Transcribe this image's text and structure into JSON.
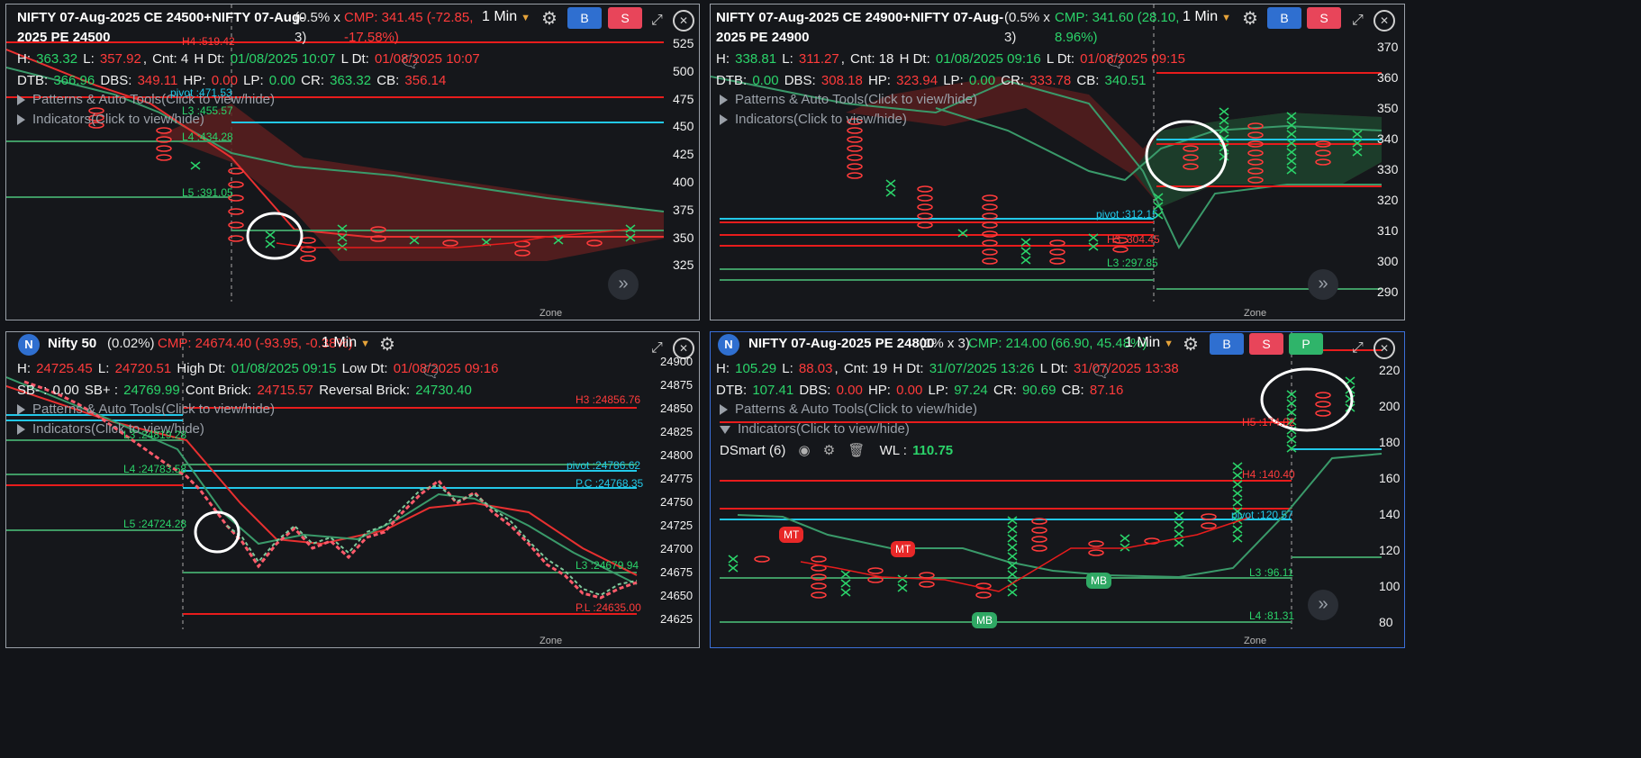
{
  "p1": {
    "title1": "NIFTY 07-Aug-2025 CE 24500+NIFTY 07-Aug-",
    "title2": "2025 PE 24500",
    "pct1": "(0.5% x",
    "pct2": "3)",
    "cmp1": "CMP: 341.45 (-72.85,",
    "cmp2": "-17.58%)",
    "timeframe": "1 Min",
    "h_lbl": "H:",
    "h": "363.32",
    "l_lbl": "L:",
    "l": "357.92",
    "cnt": "Cnt: 4",
    "hdt_lbl": "H Dt:",
    "hdt": "01/08/2025 10:07",
    "ldt_lbl": "L Dt:",
    "ldt": "01/08/2025 10:07",
    "dtb_lbl": "DTB:",
    "dtb": "366.96",
    "dbs_lbl": "DBS:",
    "dbs": "349.11",
    "hp_lbl": "HP:",
    "hp": "0.00",
    "lp_lbl": "LP:",
    "lp": "0.00",
    "cr_lbl": "CR:",
    "cr": "363.32",
    "cb_lbl": "CB:",
    "cb": "356.14",
    "patterns": "Patterns & Auto Tools(Click to view/hide)",
    "indicators": "Indicators(Click to view/hide)",
    "levels": {
      "h4": "H4 :519.42",
      "pivot": "pivot :471.53",
      "l3": "L3 :455.57",
      "l4": "L4 :434.28",
      "l5": "L5 :391.05"
    },
    "axis": [
      "525",
      "500",
      "475",
      "450",
      "425",
      "400",
      "375",
      "350",
      "325"
    ],
    "zone": "Zone (www.definedgesecurities.com)"
  },
  "p2": {
    "title1": "NIFTY 07-Aug-2025 CE 24900+NIFTY 07-Aug-",
    "title2": "2025 PE 24900",
    "pct1": "(0.5% x",
    "pct2": "3)",
    "cmp1": "CMP: 341.60 (28.10,",
    "cmp2": "8.96%)",
    "timeframe": "1 Min",
    "h_lbl": "H:",
    "h": "338.81",
    "l_lbl": "L:",
    "l": "311.27",
    "cnt": "Cnt: 18",
    "hdt_lbl": "H Dt:",
    "hdt": "01/08/2025 09:16",
    "ldt_lbl": "L Dt:",
    "ldt": "01/08/2025 09:15",
    "dtb_lbl": "DTB:",
    "dtb": "0.00",
    "dbs_lbl": "DBS:",
    "dbs": "308.18",
    "hp_lbl": "HP:",
    "hp": "323.94",
    "lp_lbl": "LP:",
    "lp": "0.00",
    "cr_lbl": "CR:",
    "cr": "333.78",
    "cb_lbl": "CB:",
    "cb": "340.51",
    "patterns": "Patterns & Auto Tools(Click to view/hide)",
    "indicators": "Indicators(Click to view/hide)",
    "levels": {
      "pivot": "pivot :312.15",
      "h3": "H3 :304.45",
      "l3": "L3 :297.85"
    },
    "axis": [
      "370",
      "360",
      "350",
      "340",
      "330",
      "320",
      "310",
      "300",
      "290"
    ],
    "zone": "Zone (www.definedgesecurities.com)"
  },
  "p3": {
    "badge": "N",
    "title": "Nifty 50",
    "pct": "(0.02%)",
    "cmp": "CMP: 24674.40 (-93.95, -0.38%)",
    "timeframe": "1 Min",
    "h_lbl": "H:",
    "h": "24725.45",
    "l_lbl": "L:",
    "l": "24720.51",
    "hdt_lbl": "High Dt:",
    "hdt": "01/08/2025 09:15",
    "ldt_lbl": "Low Dt:",
    "ldt": "01/08/2025 09:16",
    "sb_lbl": "SB- :",
    "sb": "0.00",
    "sbp_lbl": "SB+ :",
    "sbp": "24769.99",
    "cont_lbl": "Cont Brick:",
    "cont": "24715.57",
    "rev_lbl": "Reversal Brick:",
    "rev": "24730.40",
    "patterns": "Patterns & Auto Tools(Click to view/hide)",
    "indicators": "Indicators(Click to view/hide)",
    "levels": {
      "h3": "H3 :24856.76",
      "l3": "L3 :24819.28",
      "l4": "L4 :24783.58",
      "pivot": "pivot :24786.62",
      "pc": "P.C :24768.35",
      "l5": "L5 :24724.28",
      "l3b": "L3 :24679.94",
      "pl": "P.L :24635.00"
    },
    "axis": [
      "24900",
      "24875",
      "24850",
      "24825",
      "24800",
      "24775",
      "24750",
      "24725",
      "24700",
      "24675",
      "24650",
      "24625"
    ],
    "zone": "Zone (www.definedgesecurities.com)"
  },
  "p4": {
    "badge": "N",
    "title": "NIFTY 07-Aug-2025 PE 24800",
    "pct": "(1% x 3)",
    "cmp": "CMP: 214.00 (66.90, 45.48%)",
    "timeframe": "1 Min",
    "h_lbl": "H:",
    "h": "105.29",
    "l_lbl": "L:",
    "l": "88.03",
    "cnt": "Cnt: 19",
    "hdt_lbl": "H Dt:",
    "hdt": "31/07/2025 13:26",
    "ldt_lbl": "L Dt:",
    "ldt": "31/07/2025 13:38",
    "dtb_lbl": "DTB:",
    "dtb": "107.41",
    "dbs_lbl": "DBS:",
    "dbs": "0.00",
    "hp_lbl": "HP:",
    "hp": "0.00",
    "lp_lbl": "LP:",
    "lp": "97.24",
    "cr_lbl": "CR:",
    "cr": "90.69",
    "cb_lbl": "CB:",
    "cb": "87.16",
    "patterns": "Patterns & Auto Tools(Click to view/hide)",
    "indicators": "Indicators(Click to view/hide)",
    "dsmart": "DSmart (6)",
    "wl_lbl": "WL :",
    "wl": "110.75",
    "levels": {
      "h5": "H5 :174.02",
      "h4": "H4 :140.40",
      "pivot": "pivot :120.57",
      "l3": "L3 :96.11",
      "l4": "L4 :81.31"
    },
    "marks": {
      "mt1": "MT",
      "mt2": "MT",
      "mb1": "MB",
      "mb2": "MB"
    },
    "axis": [
      "220",
      "200",
      "180",
      "160",
      "140",
      "120",
      "100",
      "80"
    ],
    "zone": "Zone (www.definedgesecurities.com)"
  },
  "buttons": {
    "buy": "B",
    "sell": "S",
    "paper": "P",
    "nav": "»"
  },
  "colors": {
    "up": "#2bd46a",
    "down": "#ff3b3b",
    "level_red": "#e81c1c",
    "level_green": "#3f9a64",
    "level_cyan": "#22c8e8",
    "ema_green": "#3a9a6a",
    "ema_red": "#e83030"
  }
}
